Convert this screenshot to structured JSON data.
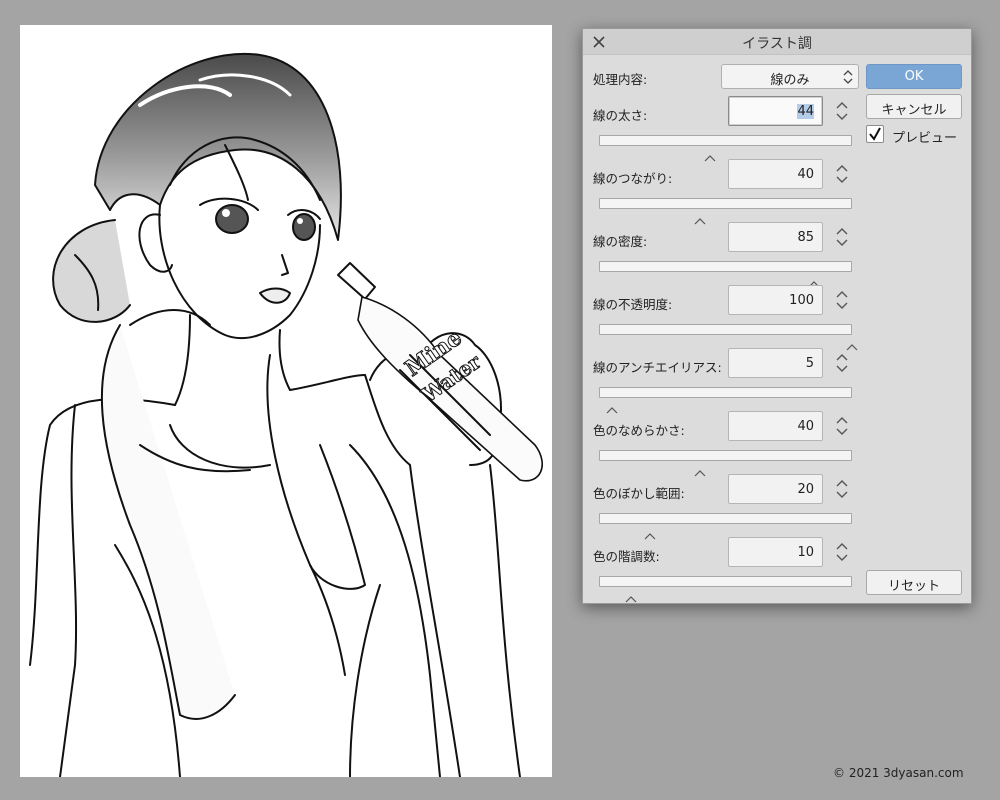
{
  "dialog": {
    "title": "イラスト調",
    "process_label": "処理内容:",
    "process_value": "線のみ",
    "ok_label": "OK",
    "cancel_label": "キャンセル",
    "preview_label": "プレビュー",
    "preview_checked": true,
    "reset_label": "リセット"
  },
  "params": [
    {
      "label": "線の太さ:",
      "value": "44",
      "level": 0.44
    },
    {
      "label": "線のつながり:",
      "value": "40",
      "level": 0.4
    },
    {
      "label": "線の密度:",
      "value": "85",
      "level": 0.85
    },
    {
      "label": "線の不透明度:",
      "value": "100",
      "level": 1.0
    },
    {
      "label": "線のアンチエイリアス:",
      "value": "5",
      "level": 0.05
    },
    {
      "label": "色のなめらかさ:",
      "value": "40",
      "level": 0.4
    },
    {
      "label": "色のぼかし範囲:",
      "value": "20",
      "level": 0.2
    },
    {
      "label": "色の階調数:",
      "value": "10",
      "level": 0.125
    }
  ],
  "bottle_text": [
    "Mine",
    "Water"
  ],
  "copyright": "© 2021 3dyasan.com"
}
